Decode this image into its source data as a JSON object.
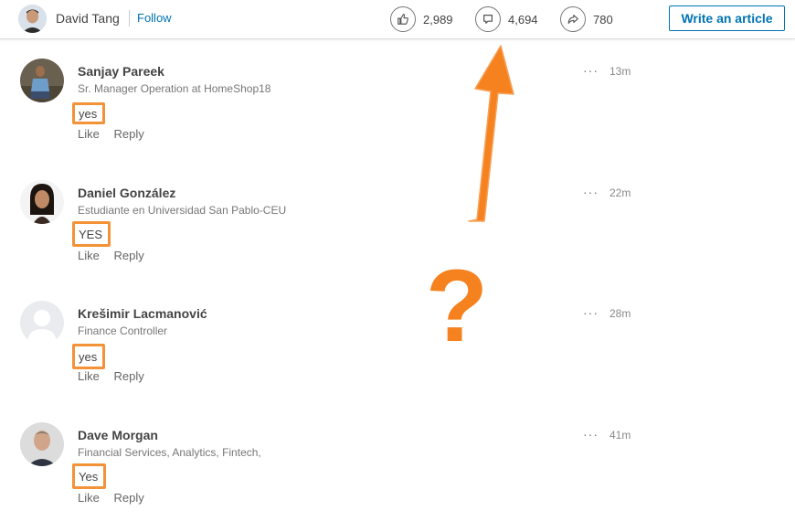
{
  "header": {
    "author_name": "David Tang",
    "follow_label": "Follow",
    "likes_count": "2,989",
    "comments_count": "4,694",
    "shares_count": "780",
    "write_article_label": "Write an article"
  },
  "icons": {
    "like": "thumbs-up-icon",
    "comment": "comment-bubble-icon",
    "share": "share-arrow-icon",
    "more": "more-options-icon"
  },
  "comments": [
    {
      "name": "Sanjay Pareek",
      "title": "Sr. Manager Operation at HomeShop18",
      "time": "13m",
      "text": "yes",
      "like_label": "Like",
      "reply_label": "Reply",
      "more_label": "···"
    },
    {
      "name": "Daniel González",
      "title": "Estudiante en Universidad San Pablo-CEU",
      "time": "22m",
      "text": "YES",
      "like_label": "Like",
      "reply_label": "Reply",
      "more_label": "···"
    },
    {
      "name": "Krešimir Lacmanović",
      "title": "Finance Controller",
      "time": "28m",
      "text": "yes",
      "like_label": "Like",
      "reply_label": "Reply",
      "more_label": "···"
    },
    {
      "name": "Dave Morgan",
      "title": "Financial Services, Analytics, Fintech,",
      "time": "41m",
      "text": "Yes",
      "like_label": "Like",
      "reply_label": "Reply",
      "more_label": "···"
    }
  ],
  "annotation": {
    "question_mark": "?",
    "color": "#f5821f",
    "box_color": "#f39237"
  }
}
